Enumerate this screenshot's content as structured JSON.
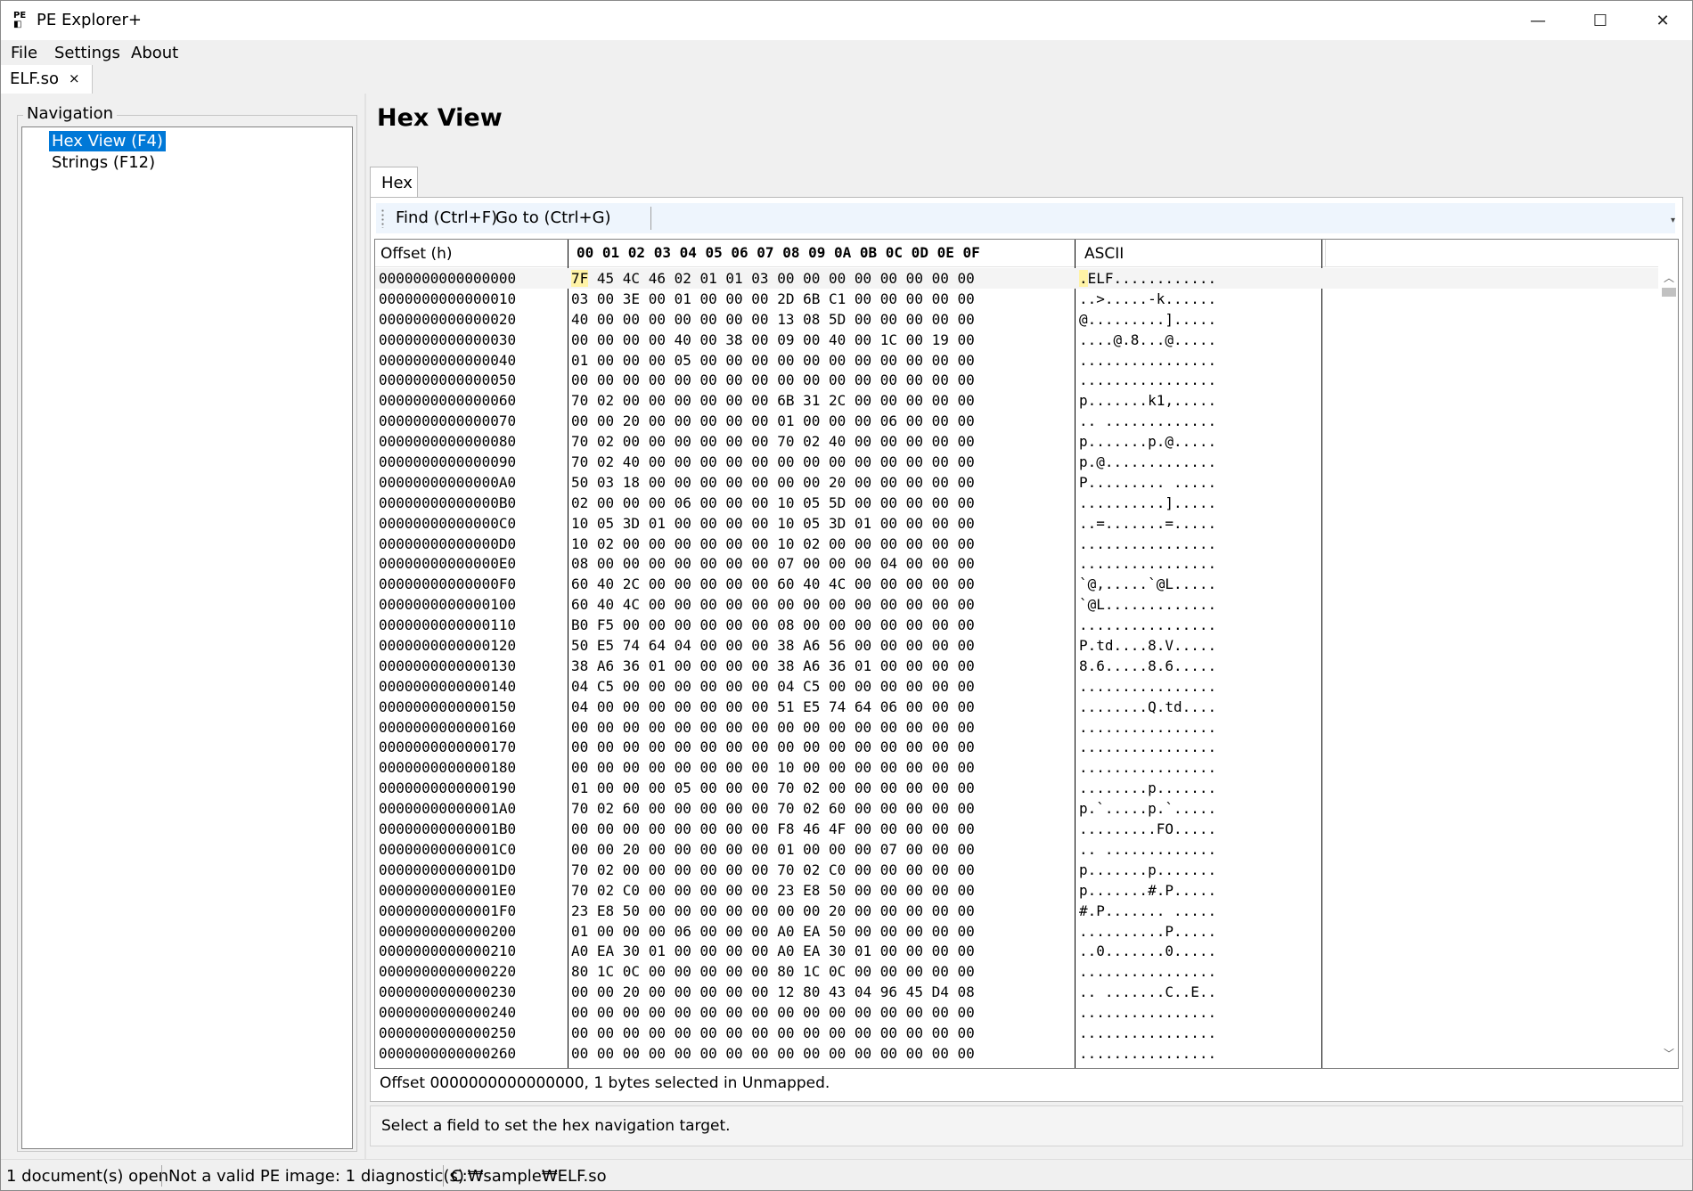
{
  "window": {
    "title": "PE Explorer+",
    "icon": "pe-app-icon",
    "controls": {
      "minimize": "—",
      "maximize": "☐",
      "close": "✕"
    }
  },
  "menu": {
    "file": "File",
    "settings": "Settings",
    "about": "About"
  },
  "doc_tab": {
    "label": "ELF.so",
    "close": "×"
  },
  "navigation": {
    "legend": "Navigation",
    "items": [
      {
        "label": "Hex View (F4)",
        "selected": true
      },
      {
        "label": "Strings (F12)",
        "selected": false
      }
    ]
  },
  "main": {
    "title": "Hex View",
    "tab": "Hex",
    "toolbar": {
      "find": "Find (Ctrl+F)",
      "goto": "Go to (Ctrl+G)"
    },
    "grid": {
      "headers": {
        "offset": "Offset (h)",
        "hex": "00 01 02 03 04 05 06 07 08 09 0A 0B 0C 0D 0E 0F",
        "ascii": "ASCII"
      },
      "rows": [
        {
          "offset": "0000000000000000",
          "hex": "7F 45 4C 46 02 01 01 03 00 00 00 00 00 00 00 00",
          "ascii": ".ELF............"
        },
        {
          "offset": "0000000000000010",
          "hex": "03 00 3E 00 01 00 00 00 2D 6B C1 00 00 00 00 00",
          "ascii": "..>.....-k......"
        },
        {
          "offset": "0000000000000020",
          "hex": "40 00 00 00 00 00 00 00 13 08 5D 00 00 00 00 00",
          "ascii": "@.........]....."
        },
        {
          "offset": "0000000000000030",
          "hex": "00 00 00 00 40 00 38 00 09 00 40 00 1C 00 19 00",
          "ascii": "....@.8...@....."
        },
        {
          "offset": "0000000000000040",
          "hex": "01 00 00 00 05 00 00 00 00 00 00 00 00 00 00 00",
          "ascii": "................"
        },
        {
          "offset": "0000000000000050",
          "hex": "00 00 00 00 00 00 00 00 00 00 00 00 00 00 00 00",
          "ascii": "................"
        },
        {
          "offset": "0000000000000060",
          "hex": "70 02 00 00 00 00 00 00 6B 31 2C 00 00 00 00 00",
          "ascii": "p.......k1,....."
        },
        {
          "offset": "0000000000000070",
          "hex": "00 00 20 00 00 00 00 00 01 00 00 00 06 00 00 00",
          "ascii": ".. ............."
        },
        {
          "offset": "0000000000000080",
          "hex": "70 02 00 00 00 00 00 00 70 02 40 00 00 00 00 00",
          "ascii": "p.......p.@....."
        },
        {
          "offset": "0000000000000090",
          "hex": "70 02 40 00 00 00 00 00 00 00 00 00 00 00 00 00",
          "ascii": "p.@............."
        },
        {
          "offset": "00000000000000A0",
          "hex": "50 03 18 00 00 00 00 00 00 00 20 00 00 00 00 00",
          "ascii": "P......... ....."
        },
        {
          "offset": "00000000000000B0",
          "hex": "02 00 00 00 06 00 00 00 10 05 5D 00 00 00 00 00",
          "ascii": "..........]....."
        },
        {
          "offset": "00000000000000C0",
          "hex": "10 05 3D 01 00 00 00 00 10 05 3D 01 00 00 00 00",
          "ascii": "..=.......=....."
        },
        {
          "offset": "00000000000000D0",
          "hex": "10 02 00 00 00 00 00 00 10 02 00 00 00 00 00 00",
          "ascii": "................"
        },
        {
          "offset": "00000000000000E0",
          "hex": "08 00 00 00 00 00 00 00 07 00 00 00 04 00 00 00",
          "ascii": "................"
        },
        {
          "offset": "00000000000000F0",
          "hex": "60 40 2C 00 00 00 00 00 60 40 4C 00 00 00 00 00",
          "ascii": "`@,.....`@L....."
        },
        {
          "offset": "0000000000000100",
          "hex": "60 40 4C 00 00 00 00 00 00 00 00 00 00 00 00 00",
          "ascii": "`@L............."
        },
        {
          "offset": "0000000000000110",
          "hex": "B0 F5 00 00 00 00 00 00 08 00 00 00 00 00 00 00",
          "ascii": "................"
        },
        {
          "offset": "0000000000000120",
          "hex": "50 E5 74 64 04 00 00 00 38 A6 56 00 00 00 00 00",
          "ascii": "P.td....8.V....."
        },
        {
          "offset": "0000000000000130",
          "hex": "38 A6 36 01 00 00 00 00 38 A6 36 01 00 00 00 00",
          "ascii": "8.6.....8.6....."
        },
        {
          "offset": "0000000000000140",
          "hex": "04 C5 00 00 00 00 00 00 04 C5 00 00 00 00 00 00",
          "ascii": "................"
        },
        {
          "offset": "0000000000000150",
          "hex": "04 00 00 00 00 00 00 00 51 E5 74 64 06 00 00 00",
          "ascii": "........Q.td...."
        },
        {
          "offset": "0000000000000160",
          "hex": "00 00 00 00 00 00 00 00 00 00 00 00 00 00 00 00",
          "ascii": "................"
        },
        {
          "offset": "0000000000000170",
          "hex": "00 00 00 00 00 00 00 00 00 00 00 00 00 00 00 00",
          "ascii": "................"
        },
        {
          "offset": "0000000000000180",
          "hex": "00 00 00 00 00 00 00 00 10 00 00 00 00 00 00 00",
          "ascii": "................"
        },
        {
          "offset": "0000000000000190",
          "hex": "01 00 00 00 05 00 00 00 70 02 00 00 00 00 00 00",
          "ascii": "........p......."
        },
        {
          "offset": "00000000000001A0",
          "hex": "70 02 60 00 00 00 00 00 70 02 60 00 00 00 00 00",
          "ascii": "p.`.....p.`....."
        },
        {
          "offset": "00000000000001B0",
          "hex": "00 00 00 00 00 00 00 00 F8 46 4F 00 00 00 00 00",
          "ascii": ".........FO....."
        },
        {
          "offset": "00000000000001C0",
          "hex": "00 00 20 00 00 00 00 00 01 00 00 00 07 00 00 00",
          "ascii": ".. ............."
        },
        {
          "offset": "00000000000001D0",
          "hex": "70 02 00 00 00 00 00 00 70 02 C0 00 00 00 00 00",
          "ascii": "p.......p......."
        },
        {
          "offset": "00000000000001E0",
          "hex": "70 02 C0 00 00 00 00 00 23 E8 50 00 00 00 00 00",
          "ascii": "p.......#.P....."
        },
        {
          "offset": "00000000000001F0",
          "hex": "23 E8 50 00 00 00 00 00 00 00 20 00 00 00 00 00",
          "ascii": "#.P....... ....."
        },
        {
          "offset": "0000000000000200",
          "hex": "01 00 00 00 06 00 00 00 A0 EA 50 00 00 00 00 00",
          "ascii": "..........P....."
        },
        {
          "offset": "0000000000000210",
          "hex": "A0 EA 30 01 00 00 00 00 A0 EA 30 01 00 00 00 00",
          "ascii": "..0.......0....."
        },
        {
          "offset": "0000000000000220",
          "hex": "80 1C 0C 00 00 00 00 00 80 1C 0C 00 00 00 00 00",
          "ascii": "................"
        },
        {
          "offset": "0000000000000230",
          "hex": "00 00 20 00 00 00 00 00 12 80 43 04 96 45 D4 08",
          "ascii": ".. .......C..E.."
        },
        {
          "offset": "0000000000000240",
          "hex": "00 00 00 00 00 00 00 00 00 00 00 00 00 00 00 00",
          "ascii": "................"
        },
        {
          "offset": "0000000000000250",
          "hex": "00 00 00 00 00 00 00 00 00 00 00 00 00 00 00 00",
          "ascii": "................"
        },
        {
          "offset": "0000000000000260",
          "hex": "00 00 00 00 00 00 00 00 00 00 00 00 00 00 00 00",
          "ascii": "................"
        }
      ],
      "selection": {
        "row": 0,
        "byte": "7F",
        "color": "#fff3a6"
      }
    },
    "hex_status": "Offset 0000000000000000, 1 bytes selected in Unmapped.",
    "message": "Select a field to set the hex navigation target."
  },
  "statusbar": {
    "documents": "1 document(s) open",
    "diagnostics": "Not a valid PE image: 1 diagnostic(s)",
    "path": "C:₩sample₩ELF.so"
  },
  "colors": {
    "selection": "#0078d7",
    "toolbar": "#eef5fd",
    "chrome": "#f0f0f0"
  }
}
